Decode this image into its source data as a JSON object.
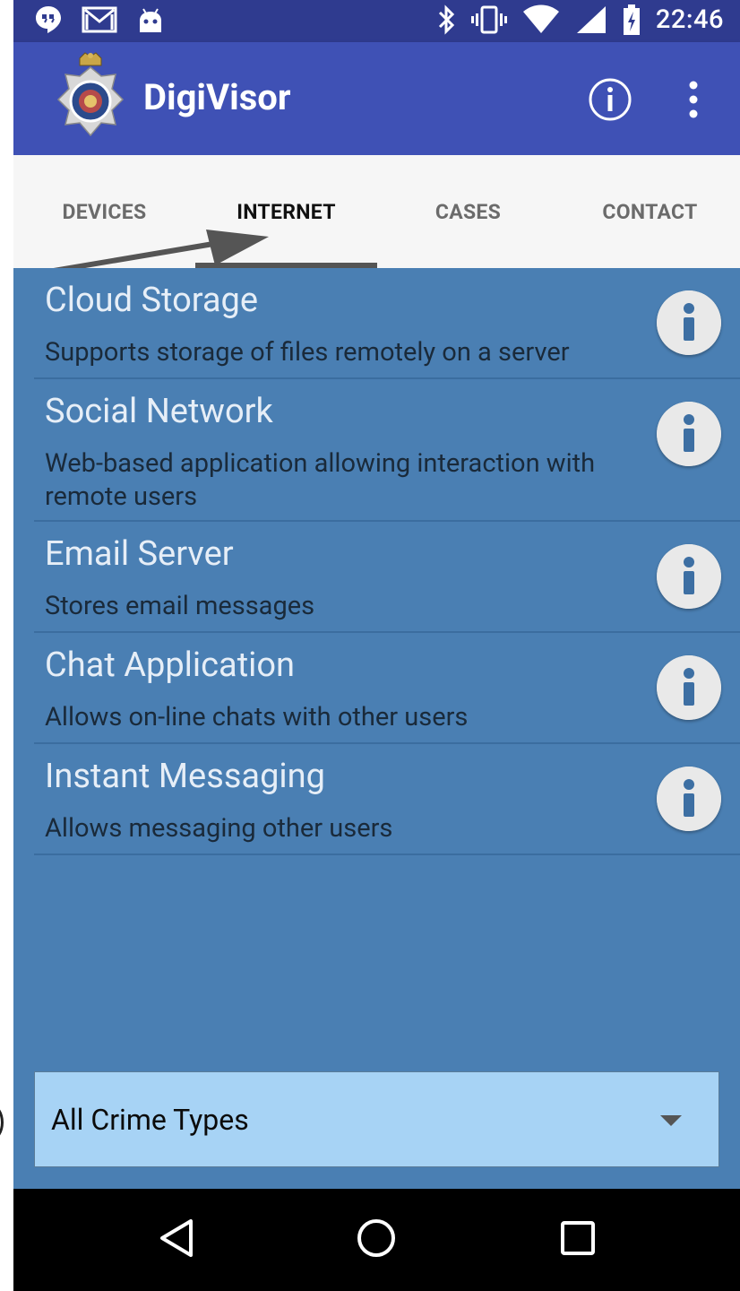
{
  "status_bar": {
    "time": "22:46",
    "left_icons": [
      "hangouts-icon",
      "gmail-icon",
      "android-icon"
    ],
    "right_icons": [
      "bluetooth-icon",
      "vibrate-icon",
      "wifi-icon",
      "signal-icon",
      "battery-charging-icon"
    ]
  },
  "app_bar": {
    "title": "DigiVisor",
    "actions": [
      "info-icon",
      "overflow-menu-icon"
    ]
  },
  "tabs": [
    {
      "label": "DEVICES",
      "active": false
    },
    {
      "label": "INTERNET",
      "active": true
    },
    {
      "label": "CASES",
      "active": false
    },
    {
      "label": "CONTACT",
      "active": false
    }
  ],
  "items": [
    {
      "title": "Cloud Storage",
      "description": "Supports storage of files remotely on a server"
    },
    {
      "title": "Social Network",
      "description": "Web-based application allowing interaction with remote users"
    },
    {
      "title": "Email Server",
      "description": "Stores email messages"
    },
    {
      "title": "Chat Application",
      "description": "Allows on-line chats with other users"
    },
    {
      "title": "Instant Messaging",
      "description": "Allows messaging other users"
    }
  ],
  "filter": {
    "selected": "All Crime Types"
  },
  "nav_bar": [
    "back-icon",
    "home-icon",
    "recents-icon"
  ],
  "colors": {
    "status_bar": "#2f3b8f",
    "app_bar": "#3f51b5",
    "tabs_bg": "#f6f6f6",
    "content_bg": "#4a7fb3",
    "spinner_bg": "#a7d3f5"
  }
}
